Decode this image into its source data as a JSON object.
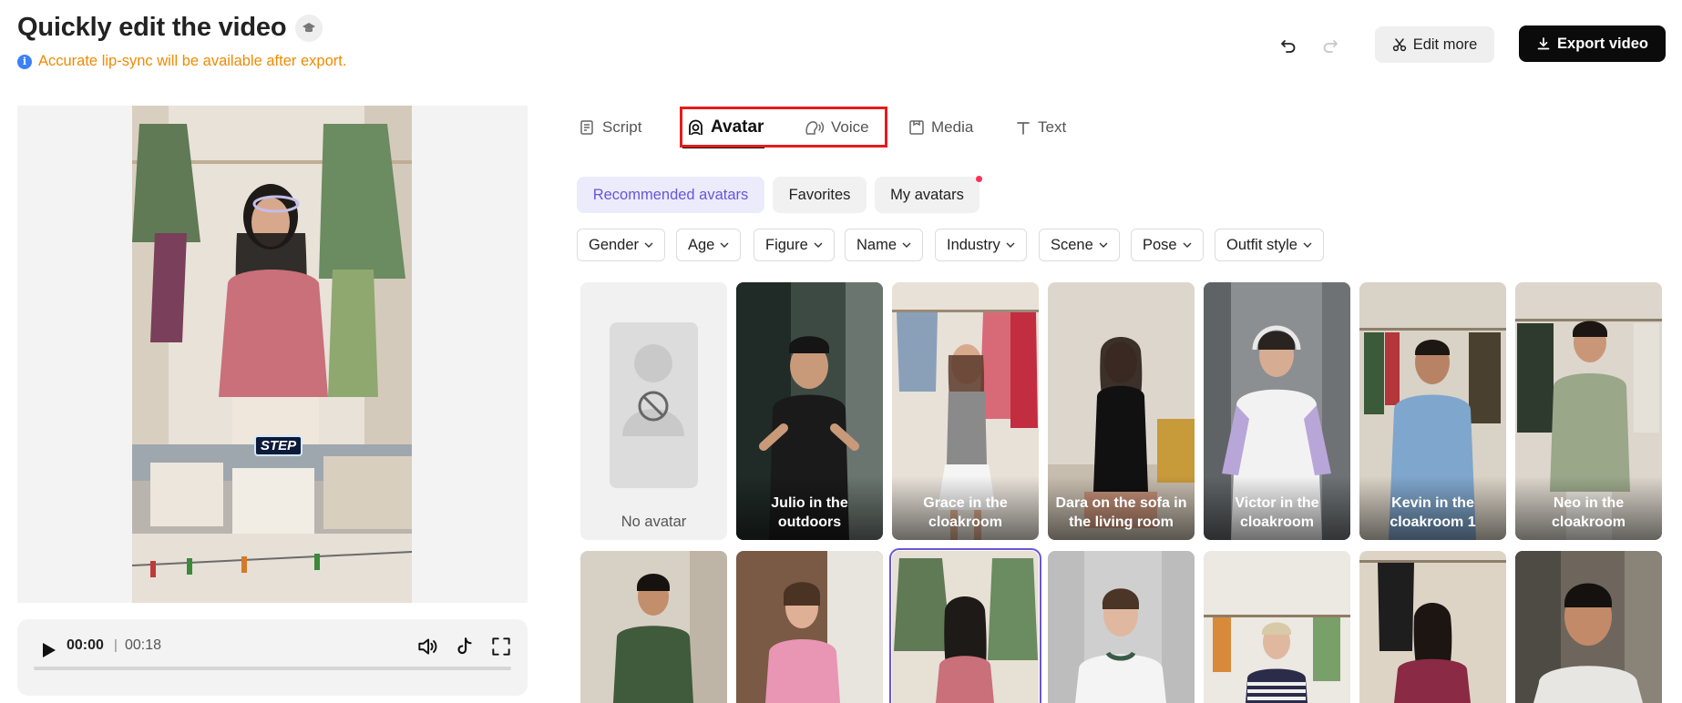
{
  "header": {
    "title": "Quickly edit the video",
    "notice": "Accurate lip-sync will be available after export.",
    "edit_more": "Edit more",
    "export": "Export video"
  },
  "player": {
    "current_time": "00:00",
    "separator": "|",
    "total_time": "00:18",
    "progress_fraction": 0
  },
  "video": {
    "caption_text": "STEP"
  },
  "tabs": [
    {
      "label": "Script",
      "icon": "script-icon",
      "active": false
    },
    {
      "label": "Avatar",
      "icon": "avatar-icon",
      "active": true
    },
    {
      "label": "Voice",
      "icon": "voice-icon",
      "active": false
    },
    {
      "label": "Media",
      "icon": "media-icon",
      "active": false
    },
    {
      "label": "Text",
      "icon": "text-icon",
      "active": false
    }
  ],
  "categories": [
    {
      "label": "Recommended avatars",
      "active": true
    },
    {
      "label": "Favorites",
      "active": false
    },
    {
      "label": "My avatars",
      "active": false
    }
  ],
  "filters": [
    "Gender",
    "Age",
    "Figure",
    "Name",
    "Industry",
    "Scene",
    "Pose",
    "Outfit style"
  ],
  "avatars": {
    "row1": [
      {
        "label": "No avatar"
      },
      {
        "label": "Julio in the outdoors"
      },
      {
        "label": "Grace in the cloakroom"
      },
      {
        "label": "Dara on the sofa in the living room"
      },
      {
        "label": "Victor in the cloakroom"
      },
      {
        "label": "Kevin in the cloakroom 1"
      },
      {
        "label": "Neo in the cloakroom"
      }
    ],
    "row2_selected_index": 2
  },
  "colors": {
    "accent": "#6a56d8",
    "highlight_box": "#e51c1c",
    "notice": "#f08a00",
    "export_bg": "#0b0b0b"
  }
}
